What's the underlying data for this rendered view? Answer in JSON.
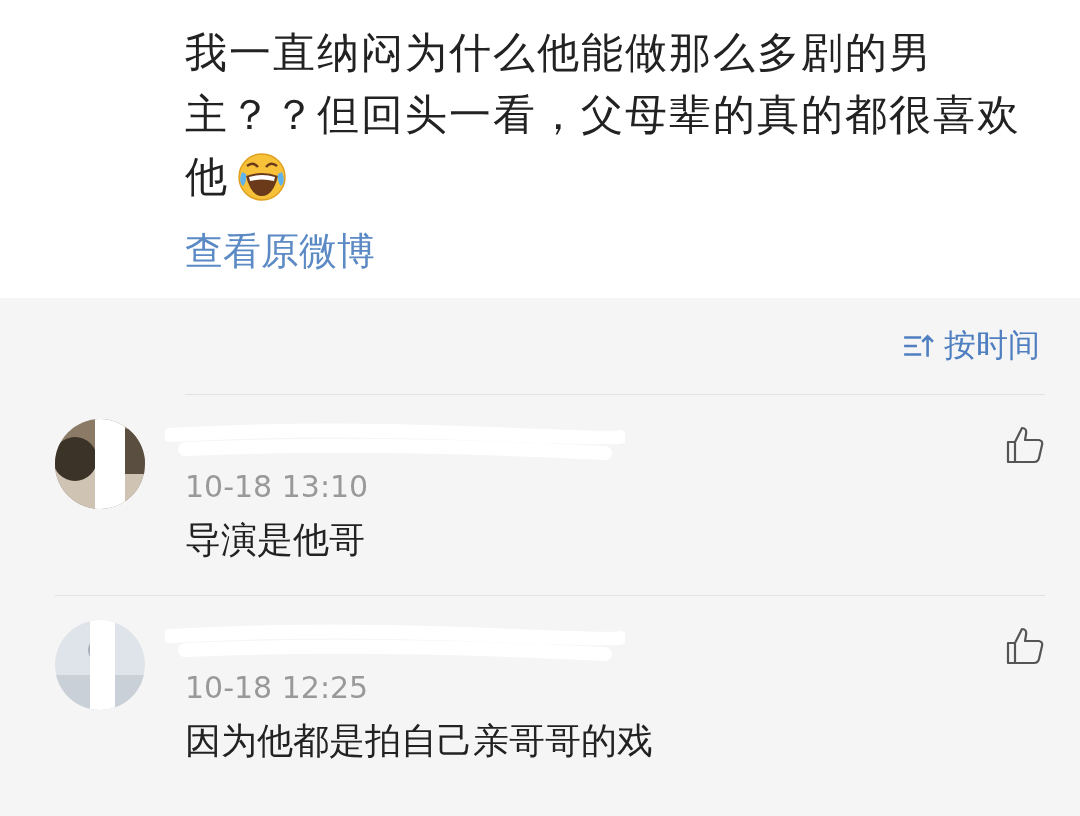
{
  "post": {
    "text": "我一直纳闷为什么他能做那么多剧的男主？？但回头一看，父母辈的真的都很喜欢",
    "last_line": "他",
    "link": "查看原微博"
  },
  "sort": {
    "label": "按时间"
  },
  "comments": [
    {
      "time": "10-18 13:10",
      "text": "导演是他哥"
    },
    {
      "time": "10-18 12:25",
      "text": "因为他都是拍自己亲哥哥的戏"
    }
  ]
}
